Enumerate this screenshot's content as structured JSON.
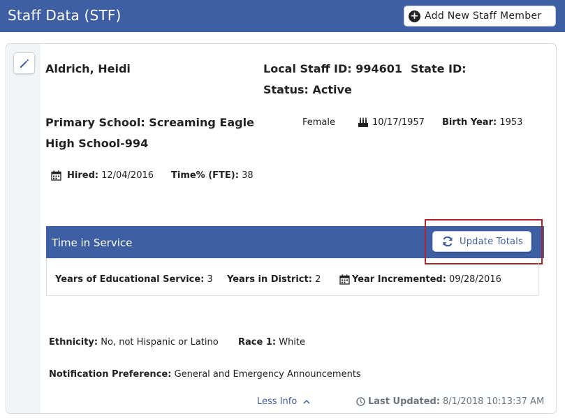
{
  "header": {
    "title": "Staff Data (STF)",
    "add_button_label": "Add New Staff Member"
  },
  "staff": {
    "name": "Aldrich, Heidi",
    "local_id_label": "Local Staff ID:",
    "local_id_value": "994601",
    "state_id_label": "State ID:",
    "status_label": "Status:",
    "status_value": "Active",
    "primary_school_line1": "Primary School: Screaming Eagle",
    "primary_school_line2": "High School-994",
    "gender": "Female",
    "birth_date": "10/17/1957",
    "birth_year_label": "Birth Year:",
    "birth_year_value": "1953",
    "hired_label": "Hired:",
    "hired_value": "12/04/2016",
    "fte_label": "Time% (FTE):",
    "fte_value": "38"
  },
  "time_in_service": {
    "title": "Time in Service",
    "update_button_label": "Update Totals",
    "years_edu_label": "Years of Educational Service:",
    "years_edu_value": "3",
    "years_district_label": "Years in District:",
    "years_district_value": "2",
    "year_incremented_label": "Year Incremented:",
    "year_incremented_value": "09/28/2016"
  },
  "details": {
    "ethnicity_label": "Ethnicity:",
    "ethnicity_value": "No, not Hispanic or Latino",
    "race_label": "Race 1:",
    "race_value": "White",
    "notification_label": "Notification Preference:",
    "notification_value": "General and Emergency Announcements"
  },
  "footer": {
    "less_info_label": "Less Info",
    "last_updated_label": "Last Updated:",
    "last_updated_value": "8/1/2018 10:13:37 AM"
  },
  "colors": {
    "brand_blue": "#3e5fa3",
    "highlight_red": "#b0242a"
  },
  "icons": {
    "add": "plus-circle-icon",
    "edit": "pencil-icon",
    "birthday": "birthday-cake-icon",
    "calendar": "calendar-icon",
    "refresh": "refresh-icon",
    "chevron": "chevron-up-icon",
    "clock": "clock-icon"
  }
}
